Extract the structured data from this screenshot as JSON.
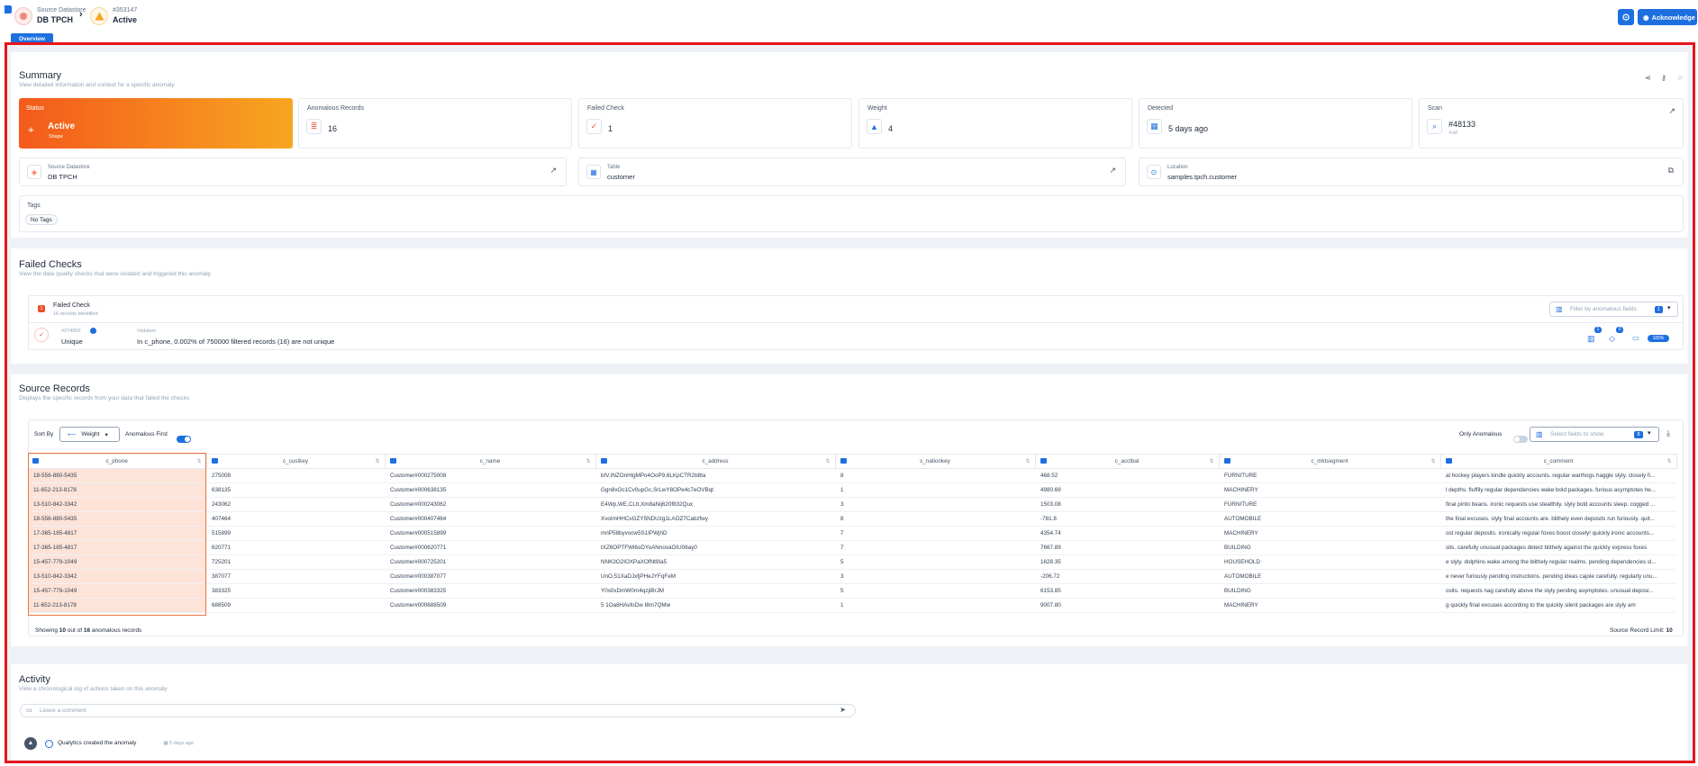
{
  "header": {
    "datastore_label": "Source Datastore",
    "datastore_name": "DB TPCH",
    "anomaly_id": "#353147",
    "anomaly_status": "Active",
    "acknowledge_label": "Acknowledge",
    "tab_overview": "Overview"
  },
  "summary": {
    "title": "Summary",
    "subtitle": "View detailed information and context for a specific anomaly",
    "status": {
      "label": "Status",
      "value": "Active",
      "sub": "Shape"
    },
    "anomalous_records": {
      "label": "Anomalous Records",
      "value": "16"
    },
    "failed_check": {
      "label": "Failed Check",
      "value": "1"
    },
    "weight": {
      "label": "Weight",
      "value": "4"
    },
    "detected": {
      "label": "Detected",
      "value": "5 days ago"
    },
    "scan": {
      "label": "Scan",
      "value": "#48133",
      "sub": "Full"
    },
    "source_datastore": {
      "label": "Source Datastore",
      "value": "DB TPCH"
    },
    "table": {
      "label": "Table",
      "value": "customer"
    },
    "location": {
      "label": "Location",
      "value": "samples.tpch.customer"
    },
    "tags": {
      "label": "Tags",
      "value": "No Tags"
    }
  },
  "failed_checks": {
    "title": "Failed Checks",
    "subtitle": "View the data quality checks that were violated and triggered this anomaly",
    "box_title": "Failed Check",
    "box_sub": "16 records identified",
    "count_badge": "1",
    "filter_placeholder": "Filter by anomalous fields",
    "filter_count": "1",
    "check_id": "#274900",
    "check_rule": "Unique",
    "violation_label": "Violation",
    "violation_text": "In c_phone, 0.002% of 750000 filtered records (16) are not unique",
    "badge_a": "1",
    "badge_b": "0",
    "badge_pct": "100%"
  },
  "source_records": {
    "title": "Source Records",
    "subtitle": "Displays the specific records from your data that failed the checks",
    "sort_by_label": "Sort By",
    "sort_value": "Weight",
    "anomalous_first_label": "Anomalous First",
    "only_anomalous_label": "Only Anomalous",
    "fields_placeholder": "Select fields to show",
    "fields_count": "8",
    "columns": [
      "c_phone",
      "c_custkey",
      "c_name",
      "c_address",
      "c_nationkey",
      "c_acctbal",
      "c_mktsegment",
      "c_comment"
    ],
    "rows": [
      [
        "18-556-880-5435",
        "275008",
        "Customer#000275008",
        "bIV.INZOnHlgMPo4OoP9,6LKpCTR2b8ta",
        "8",
        "468.52",
        "FURNITURE",
        "al hockey players kindle quickly accounts. regular warthogs haggle slyly. closely fi..."
      ],
      [
        "11-652-213-8178",
        "638135",
        "Customer#000638135",
        "Ggn8xOc1Cv0upGc,SrLwY8OPe4c7eOVBqt",
        "1",
        "4980.69",
        "MACHINERY",
        "l depths. fluffily regular dependencies wake bold packages. furious asymptotes he..."
      ],
      [
        "13-510-842-3342",
        "243062",
        "Customer#000243062",
        "E4Wp,WE,CLtt,Xm8aNij620f832Qux",
        "3",
        "1503.08",
        "FURNITURE",
        "final pinto beans. ironic requests use stealthily. slyly bold accounts sleep. cogged ..."
      ],
      [
        "18-556-880-5435",
        "407464",
        "Customer#000407464",
        "XvoImHHCvGZY5NDUzg1LAOZ7Cabzfwy",
        "8",
        "-781.8",
        "AUTOMOBILE",
        "the final excuses. slyly final accounts are. blithely even deposits run furiously. quit..."
      ],
      [
        "17-365-185-4817",
        "515899",
        "Customer#000515899",
        "mnP58byvocw5S1IPWjhD",
        "7",
        "4354.74",
        "MACHINERY",
        "ost regular deposits. ironically regular foxes boost closely! quickly ironic accounts..."
      ],
      [
        "17-365-185-4817",
        "620771",
        "Customer#000620771",
        "tXZ6OPTFWl6oDYoANnovaOIU06ay0",
        "7",
        "7667.89",
        "BUILDING",
        "sits. carefully unusual packages detect blithely against the quickly express foxes"
      ],
      [
        "15-457-779-1049",
        "725201",
        "Customer#000725201",
        "NNK3O2IOXPaXOfNt9Ia5",
        "5",
        "1628.35",
        "HOUSEHOLD",
        "e slyly. dolphins wake among the blithely regular realms. pending dependencies sl..."
      ],
      [
        "13-510-842-3342",
        "387077",
        "Customer#000387077",
        "UnO,51XaDJxfjPHeJYFqFeM",
        "3",
        "-206.72",
        "AUTOMOBILE",
        "e never furiously pending instructions. pending ideas cajole carefully. regularly unu..."
      ],
      [
        "15-457-779-1049",
        "383325",
        "Customer#000383325",
        "Y0s0xDmW0rn4qzjiBrJM",
        "5",
        "6153.85",
        "BUILDING",
        "osits. requests nag carefully above the slyly pending asymptotes. unusual deposi..."
      ],
      [
        "11-652-213-8178",
        "688509",
        "Customer#000688509",
        "5 1Oa8HAvfoDw I8m7QMw",
        "1",
        "9007.80",
        "MACHINERY",
        "g quickly final excuses according to the quickly silent packages are slyly am"
      ]
    ],
    "showing_prefix": "Showing",
    "showing_count": "10",
    "showing_mid": "out of",
    "showing_total": "16",
    "showing_suffix": "anomalous records",
    "record_limit_label": "Source Record Limit:",
    "record_limit_value": "10"
  },
  "activity": {
    "title": "Activity",
    "subtitle": "View a chronological log of actions taken on this anomaly",
    "comment_placeholder": "Leave a comment",
    "log_text": "Qualytics created the anomaly",
    "log_time": "5 days ago"
  },
  "colors": {
    "accent": "#1d6fe0",
    "status_from": "#f45a1c",
    "status_to": "#f7a620",
    "frame": "#e6151b"
  }
}
